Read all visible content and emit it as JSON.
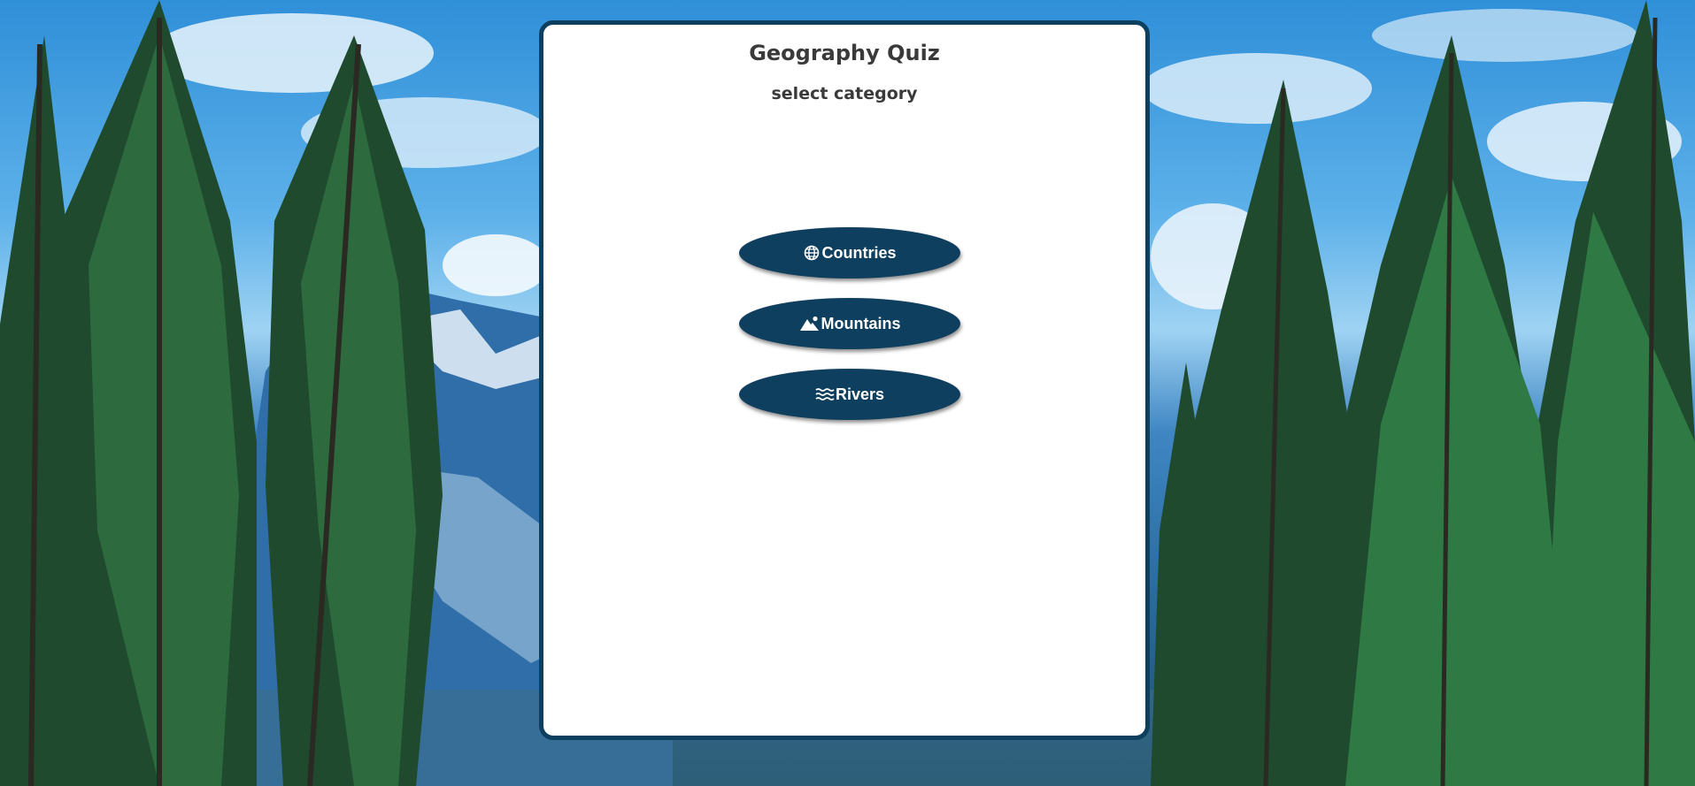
{
  "quiz": {
    "title": "Geography Quiz",
    "subtitle": "select category"
  },
  "categories": [
    {
      "label": "Countries",
      "icon": "globe-icon"
    },
    {
      "label": "Mountains",
      "icon": "mountain-icon"
    },
    {
      "label": "Rivers",
      "icon": "water-waves-icon"
    }
  ],
  "colors": {
    "card_border": "#0e3f5e",
    "button_bg": "#0e3f5e",
    "button_text": "#ffffff",
    "heading_text": "#3a3a3a",
    "card_bg": "#ffffff"
  }
}
